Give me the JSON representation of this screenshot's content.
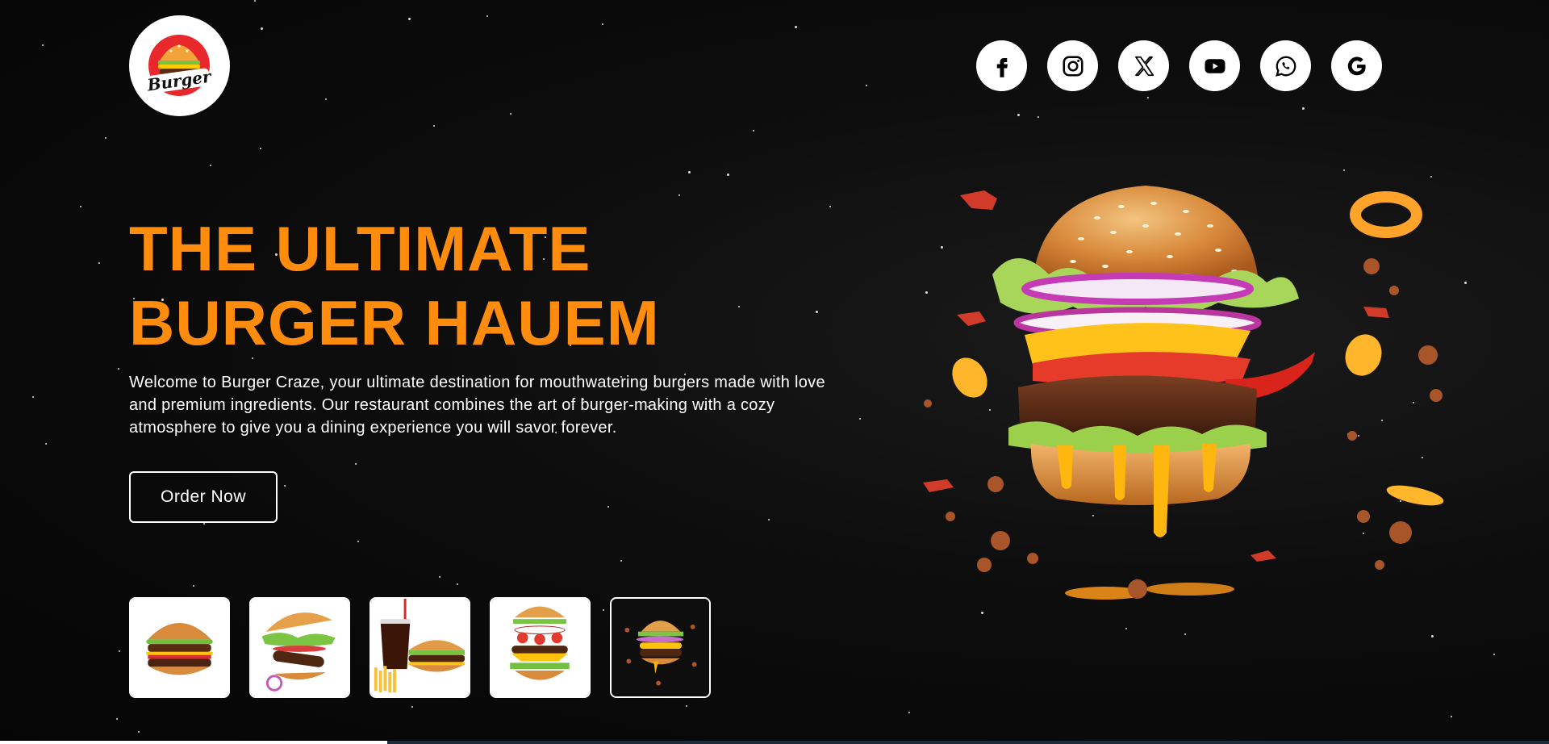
{
  "brand": {
    "logo_text": "Burger",
    "logo_icon": "burger-logo-icon"
  },
  "social": [
    {
      "name": "facebook",
      "icon": "facebook-icon"
    },
    {
      "name": "instagram",
      "icon": "instagram-icon"
    },
    {
      "name": "x",
      "icon": "x-icon"
    },
    {
      "name": "youtube",
      "icon": "youtube-icon"
    },
    {
      "name": "whatsapp",
      "icon": "whatsapp-icon"
    },
    {
      "name": "google",
      "icon": "google-icon"
    }
  ],
  "hero": {
    "title_line1": "THE ULTIMATE",
    "title_line2": "BURGER HAUEM",
    "description": "Welcome to Burger Craze, your ultimate destination for mouthwatering burgers made with love and premium ingredients. Our restaurant combines the art of burger-making with a cozy atmosphere to give you a dining experience you will savor forever.",
    "cta_label": "Order Now",
    "image": "exploding-burger-image"
  },
  "thumbnails": [
    {
      "icon": "double-cheeseburger-image"
    },
    {
      "icon": "flying-burger-image"
    },
    {
      "icon": "burger-fries-drink-image"
    },
    {
      "icon": "stacked-burger-image"
    },
    {
      "icon": "exploding-burger-thumb-image"
    }
  ],
  "slider": {
    "progress": 0.25
  },
  "colors": {
    "accent": "#ff8c0d",
    "background": "#0a0a0a",
    "text": "#ffffff",
    "button_bg": "#ffffff"
  }
}
